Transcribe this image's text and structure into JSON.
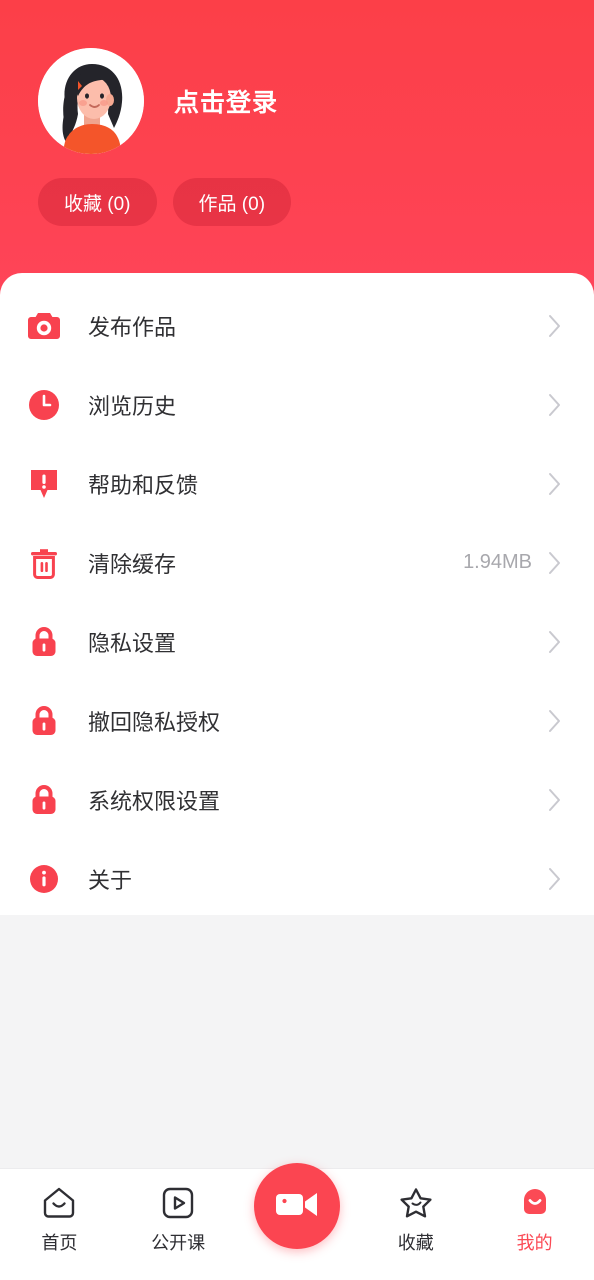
{
  "header": {
    "login_label": "点击登录",
    "avatar_icon": "user-avatar-illustration",
    "pills": [
      {
        "label": "收藏 (0)",
        "name": "favorites-count-pill"
      },
      {
        "label": "作品 (0)",
        "name": "works-count-pill"
      }
    ],
    "gradient_from": "#FC3F48",
    "gradient_to": "#FF4459"
  },
  "menu": {
    "items": [
      {
        "label": "发布作品",
        "icon": "camera-icon",
        "value": "",
        "chevron": "chevron-right-icon"
      },
      {
        "label": "浏览历史",
        "icon": "clock-icon",
        "value": "",
        "chevron": "chevron-right-icon"
      },
      {
        "label": "帮助和反馈",
        "icon": "feedback-icon",
        "value": "",
        "chevron": "chevron-right-icon"
      },
      {
        "label": "清除缓存",
        "icon": "trash-icon",
        "value": "1.94MB",
        "chevron": "chevron-right-icon"
      },
      {
        "label": "隐私设置",
        "icon": "lock-icon",
        "value": "",
        "chevron": "chevron-right-icon"
      },
      {
        "label": "撤回隐私授权",
        "icon": "lock-icon",
        "value": "",
        "chevron": "chevron-right-icon"
      },
      {
        "label": "系统权限设置",
        "icon": "lock-icon",
        "value": "",
        "chevron": "chevron-right-icon"
      },
      {
        "label": "关于",
        "icon": "info-icon",
        "value": "",
        "chevron": "chevron-right-icon"
      }
    ]
  },
  "tabbar": {
    "accent_color": "#FB4A55",
    "inactive_color": "#2E2E33",
    "tabs": [
      {
        "label": "首页",
        "icon": "home-icon",
        "active": false
      },
      {
        "label": "公开课",
        "icon": "play-box-icon",
        "active": false
      },
      {
        "label": "收藏",
        "icon": "star-icon",
        "active": false
      },
      {
        "label": "我的",
        "icon": "profile-icon",
        "active": true
      }
    ],
    "fab": {
      "icon": "video-camera-icon",
      "color": "#FB4551"
    }
  }
}
